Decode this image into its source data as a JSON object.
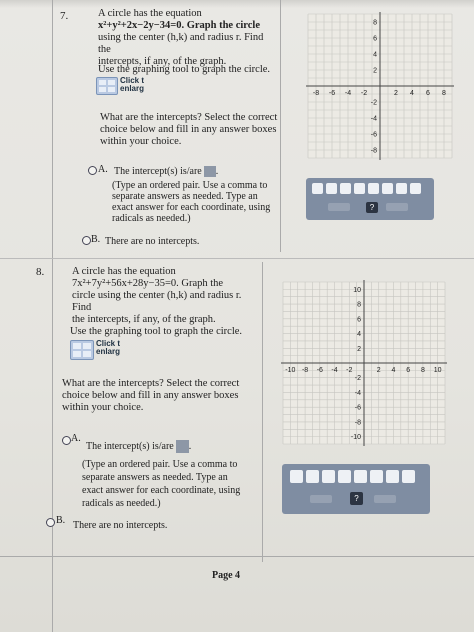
{
  "page_label": "Page 4",
  "questions": [
    {
      "number": "7.",
      "problem_line1": "A circle has the equation",
      "equation": "x²+y²+2x−2y−34=0. Graph the circle",
      "problem_line3": "using the center (h,k) and radius r. Find the",
      "problem_line4": "intercepts, if any, of the graph.",
      "instruction": "Use the graphing tool to graph the circle.",
      "click_label": "Click t",
      "enlarge_label": "enlarg",
      "prompt_line1": "What are the intercepts? Select the correct",
      "prompt_line2": "choice below and fill in any answer boxes",
      "prompt_line3": "within your choice.",
      "choice_a_letter": "A.",
      "choice_a_text": "The intercept(s) is/are",
      "hint1": "(Type an ordered pair. Use a comma to",
      "hint2": "separate answers as needed. Type an",
      "hint3": "exact answer for each coordinate, using",
      "hint4": "radicals as needed.)",
      "choice_b_letter": "B.",
      "choice_b_text": "There are no intercepts.",
      "help_button": "?",
      "graph": {
        "x_ticks": [
          "-8",
          "-6",
          "-4",
          "-2",
          "2",
          "4",
          "6",
          "8"
        ],
        "y_ticks_pos": [
          "8",
          "6",
          "4",
          "2"
        ],
        "y_ticks_neg": [
          "-2",
          "-4",
          "-6",
          "-8"
        ]
      }
    },
    {
      "number": "8.",
      "problem_line1": "A circle has the equation",
      "equation": "7x²+7y²+56x+28y−35=0. Graph the",
      "problem_line3": "circle using the center (h,k) and radius r. Find",
      "problem_line4": "the intercepts, if any, of the graph.",
      "instruction": "Use the graphing tool to graph the circle.",
      "click_label": "Click t",
      "enlarge_label": "enlarg",
      "prompt_line1": "What are the intercepts? Select the correct",
      "prompt_line2": "choice below and fill in any answer boxes",
      "prompt_line3": "within your choice.",
      "choice_a_letter": "A.",
      "choice_a_text": "The intercept(s) is/are",
      "hint1": "(Type an ordered pair. Use a comma to",
      "hint2": "separate answers as needed. Type an",
      "hint3": "exact answer for each coordinate, using",
      "hint4": "radicals as needed.)",
      "choice_b_letter": "B.",
      "choice_b_text": "There are no intercepts.",
      "help_button": "?",
      "graph": {
        "x_ticks": [
          "-10",
          "-8",
          "-6",
          "-4",
          "-2",
          "2",
          "4",
          "6",
          "8",
          "10"
        ],
        "y_ticks_pos": [
          "10",
          "8",
          "6",
          "4",
          "2"
        ],
        "y_ticks_neg": [
          "-2",
          "-4",
          "-6",
          "-8",
          "-10"
        ]
      }
    }
  ]
}
